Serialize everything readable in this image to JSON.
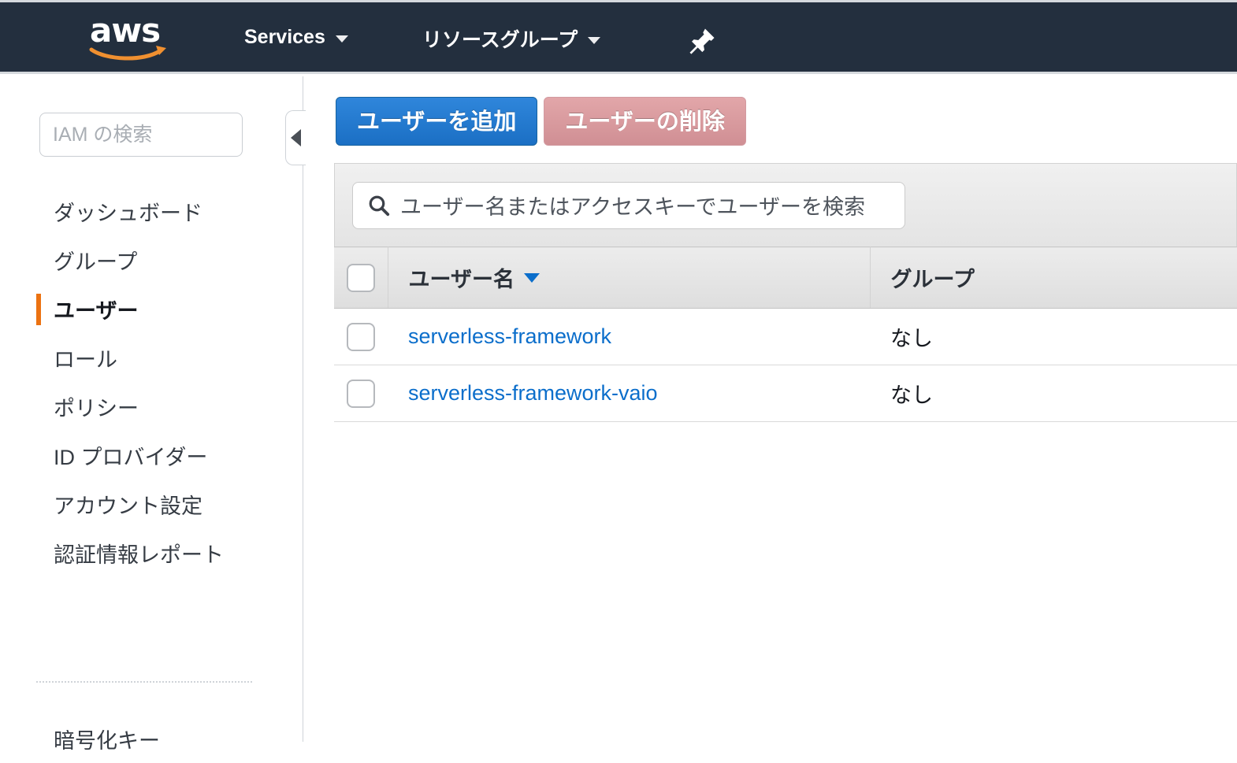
{
  "navbar": {
    "logo_alt": "aws",
    "items": [
      {
        "label": "Services",
        "icon": "chevron-down-icon"
      },
      {
        "label": "リソースグループ",
        "icon": "chevron-down-icon"
      }
    ],
    "pin_icon": "pushpin-icon",
    "background_color": "#232f3e"
  },
  "sidebar": {
    "search": {
      "placeholder": "IAM の検索",
      "value": ""
    },
    "items": [
      {
        "label": "ダッシュボード",
        "active": false
      },
      {
        "label": "グループ",
        "active": false
      },
      {
        "label": "ユーザー",
        "active": true
      },
      {
        "label": "ロール",
        "active": false
      },
      {
        "label": "ポリシー",
        "active": false
      },
      {
        "label": "ID プロバイダー",
        "active": false
      },
      {
        "label": "アカウント設定",
        "active": false
      },
      {
        "label": "認証情報レポート",
        "active": false
      }
    ],
    "secondary_items": [
      {
        "label": "暗号化キー"
      }
    ],
    "collapse_icon": "triangle-left-icon",
    "active_marker_color": "#ec7211"
  },
  "main": {
    "toolbar": {
      "add_user_label": "ユーザーを追加",
      "delete_user_label": "ユーザーの削除",
      "add_user_color": "#1b6fc4",
      "delete_user_color": "#d08f94"
    },
    "table_search": {
      "icon": "search-icon",
      "placeholder": "ユーザー名またはアクセスキーでユーザーを検索",
      "value": ""
    },
    "table": {
      "columns": [
        {
          "label": "ユーザー名",
          "sorted": true,
          "sort_direction": "desc",
          "sort_icon": "caret-down-icon"
        },
        {
          "label": "グループ",
          "sorted": false
        }
      ],
      "select_all_checked": false,
      "rows": [
        {
          "username": "serverless-framework",
          "group": "なし",
          "checked": false
        },
        {
          "username": "serverless-framework-vaio",
          "group": "なし",
          "checked": false
        }
      ]
    }
  }
}
